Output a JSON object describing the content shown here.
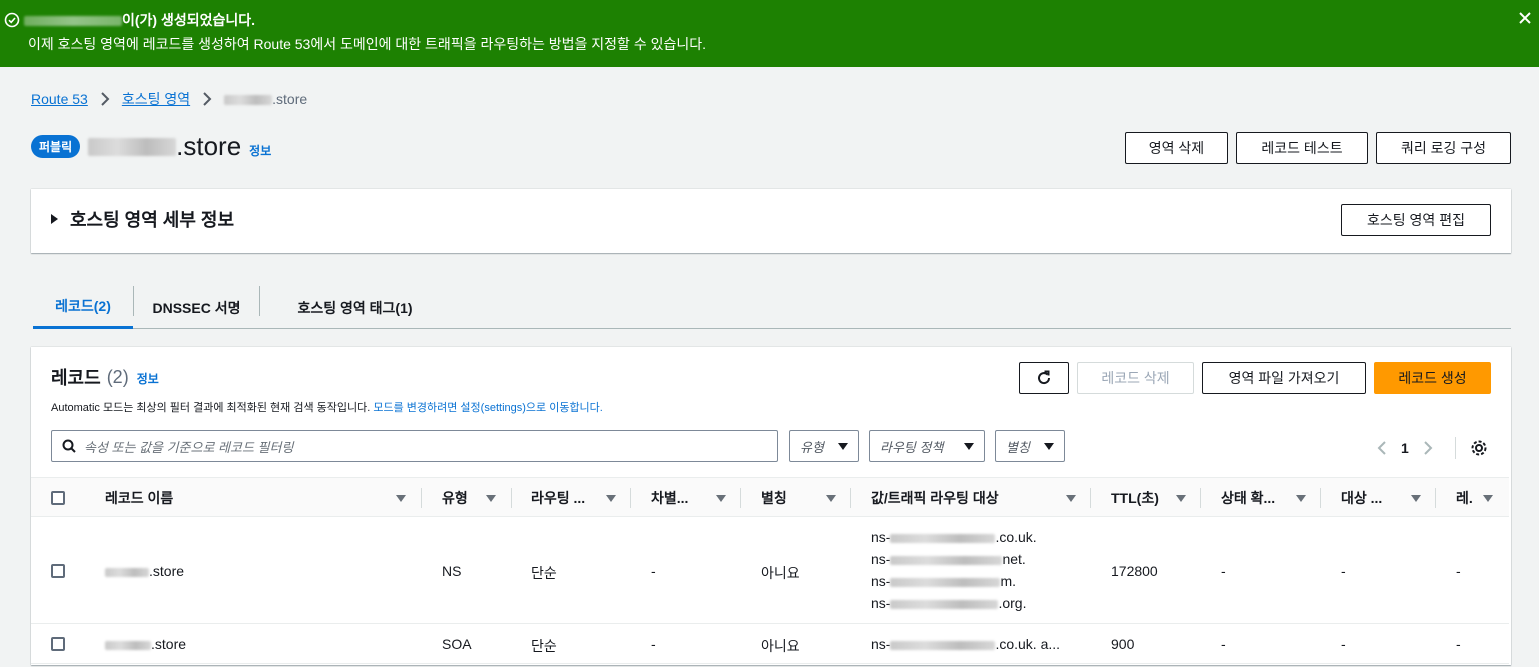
{
  "banner": {
    "title_suffix": "이(가) 생성되었습니다.",
    "message": "이제 호스팅 영역에 레코드를 생성하여 Route 53에서 도메인에 대한 트래픽을 라우팅하는 방법을 지정할 수 있습니다.",
    "color": "#1d8102"
  },
  "breadcrumb": {
    "items": [
      "Route 53",
      "호스팅 영역"
    ],
    "current_suffix": ".store"
  },
  "header": {
    "badge": "퍼블릭",
    "title_suffix": ".store",
    "info": "정보",
    "buttons": {
      "delete_zone": "영역 삭제",
      "test_record": "레코드 테스트",
      "query_logging": "쿼리 로깅 구성"
    }
  },
  "details": {
    "title": "호스팅 영역 세부 정보",
    "edit_button": "호스팅 영역 편집"
  },
  "tabs": [
    {
      "label": "레코드(2)",
      "active": true
    },
    {
      "label": "DNSSEC 서명",
      "active": false
    },
    {
      "label": "호스팅 영역 태그(1)",
      "active": false
    }
  ],
  "records": {
    "title": "레코드",
    "count": "(2)",
    "info": "정보",
    "refresh_icon": "refresh-icon",
    "buttons": {
      "delete": "레코드 삭제",
      "import": "영역 파일 가져오기",
      "create": "레코드 생성"
    },
    "description_prefix": "Automatic 모드는 최상의 필터 결과에 최적화된 현재 검색 동작입니다. ",
    "description_link": "모드를 변경하려면 설정(settings)으로 이동합니다.",
    "search_placeholder": "속성 또는 값을 기준으로 레코드 필터링",
    "filters": {
      "type": "유형",
      "routing": "라우팅 정책",
      "alias": "별칭"
    },
    "page": "1",
    "columns": [
      "레코드 이름",
      "유형",
      "라우팅 ...",
      "차별...",
      "별칭",
      "값/트래픽 라우팅 대상",
      "TTL(초)",
      "상태 확...",
      "대상 ...",
      "레."
    ],
    "rows": [
      {
        "name_suffix": ".store",
        "type": "NS",
        "routing": "단순",
        "differentiator": "-",
        "alias": "아니요",
        "values": [
          {
            "prefix": "ns-",
            "suffix": ".co.uk."
          },
          {
            "prefix": "ns-",
            "suffix": "net."
          },
          {
            "prefix": "ns-",
            "suffix": "m."
          },
          {
            "prefix": "ns-",
            "suffix": ".org."
          }
        ],
        "ttl": "172800",
        "health": "-",
        "evaluate": "-",
        "record_id": "-"
      },
      {
        "name_suffix": ".store",
        "type": "SOA",
        "routing": "단순",
        "differentiator": "-",
        "alias": "아니요",
        "values": [
          {
            "prefix": "ns-",
            "suffix": ".co.uk. a..."
          }
        ],
        "ttl": "900",
        "health": "-",
        "evaluate": "-",
        "record_id": "-"
      }
    ]
  }
}
